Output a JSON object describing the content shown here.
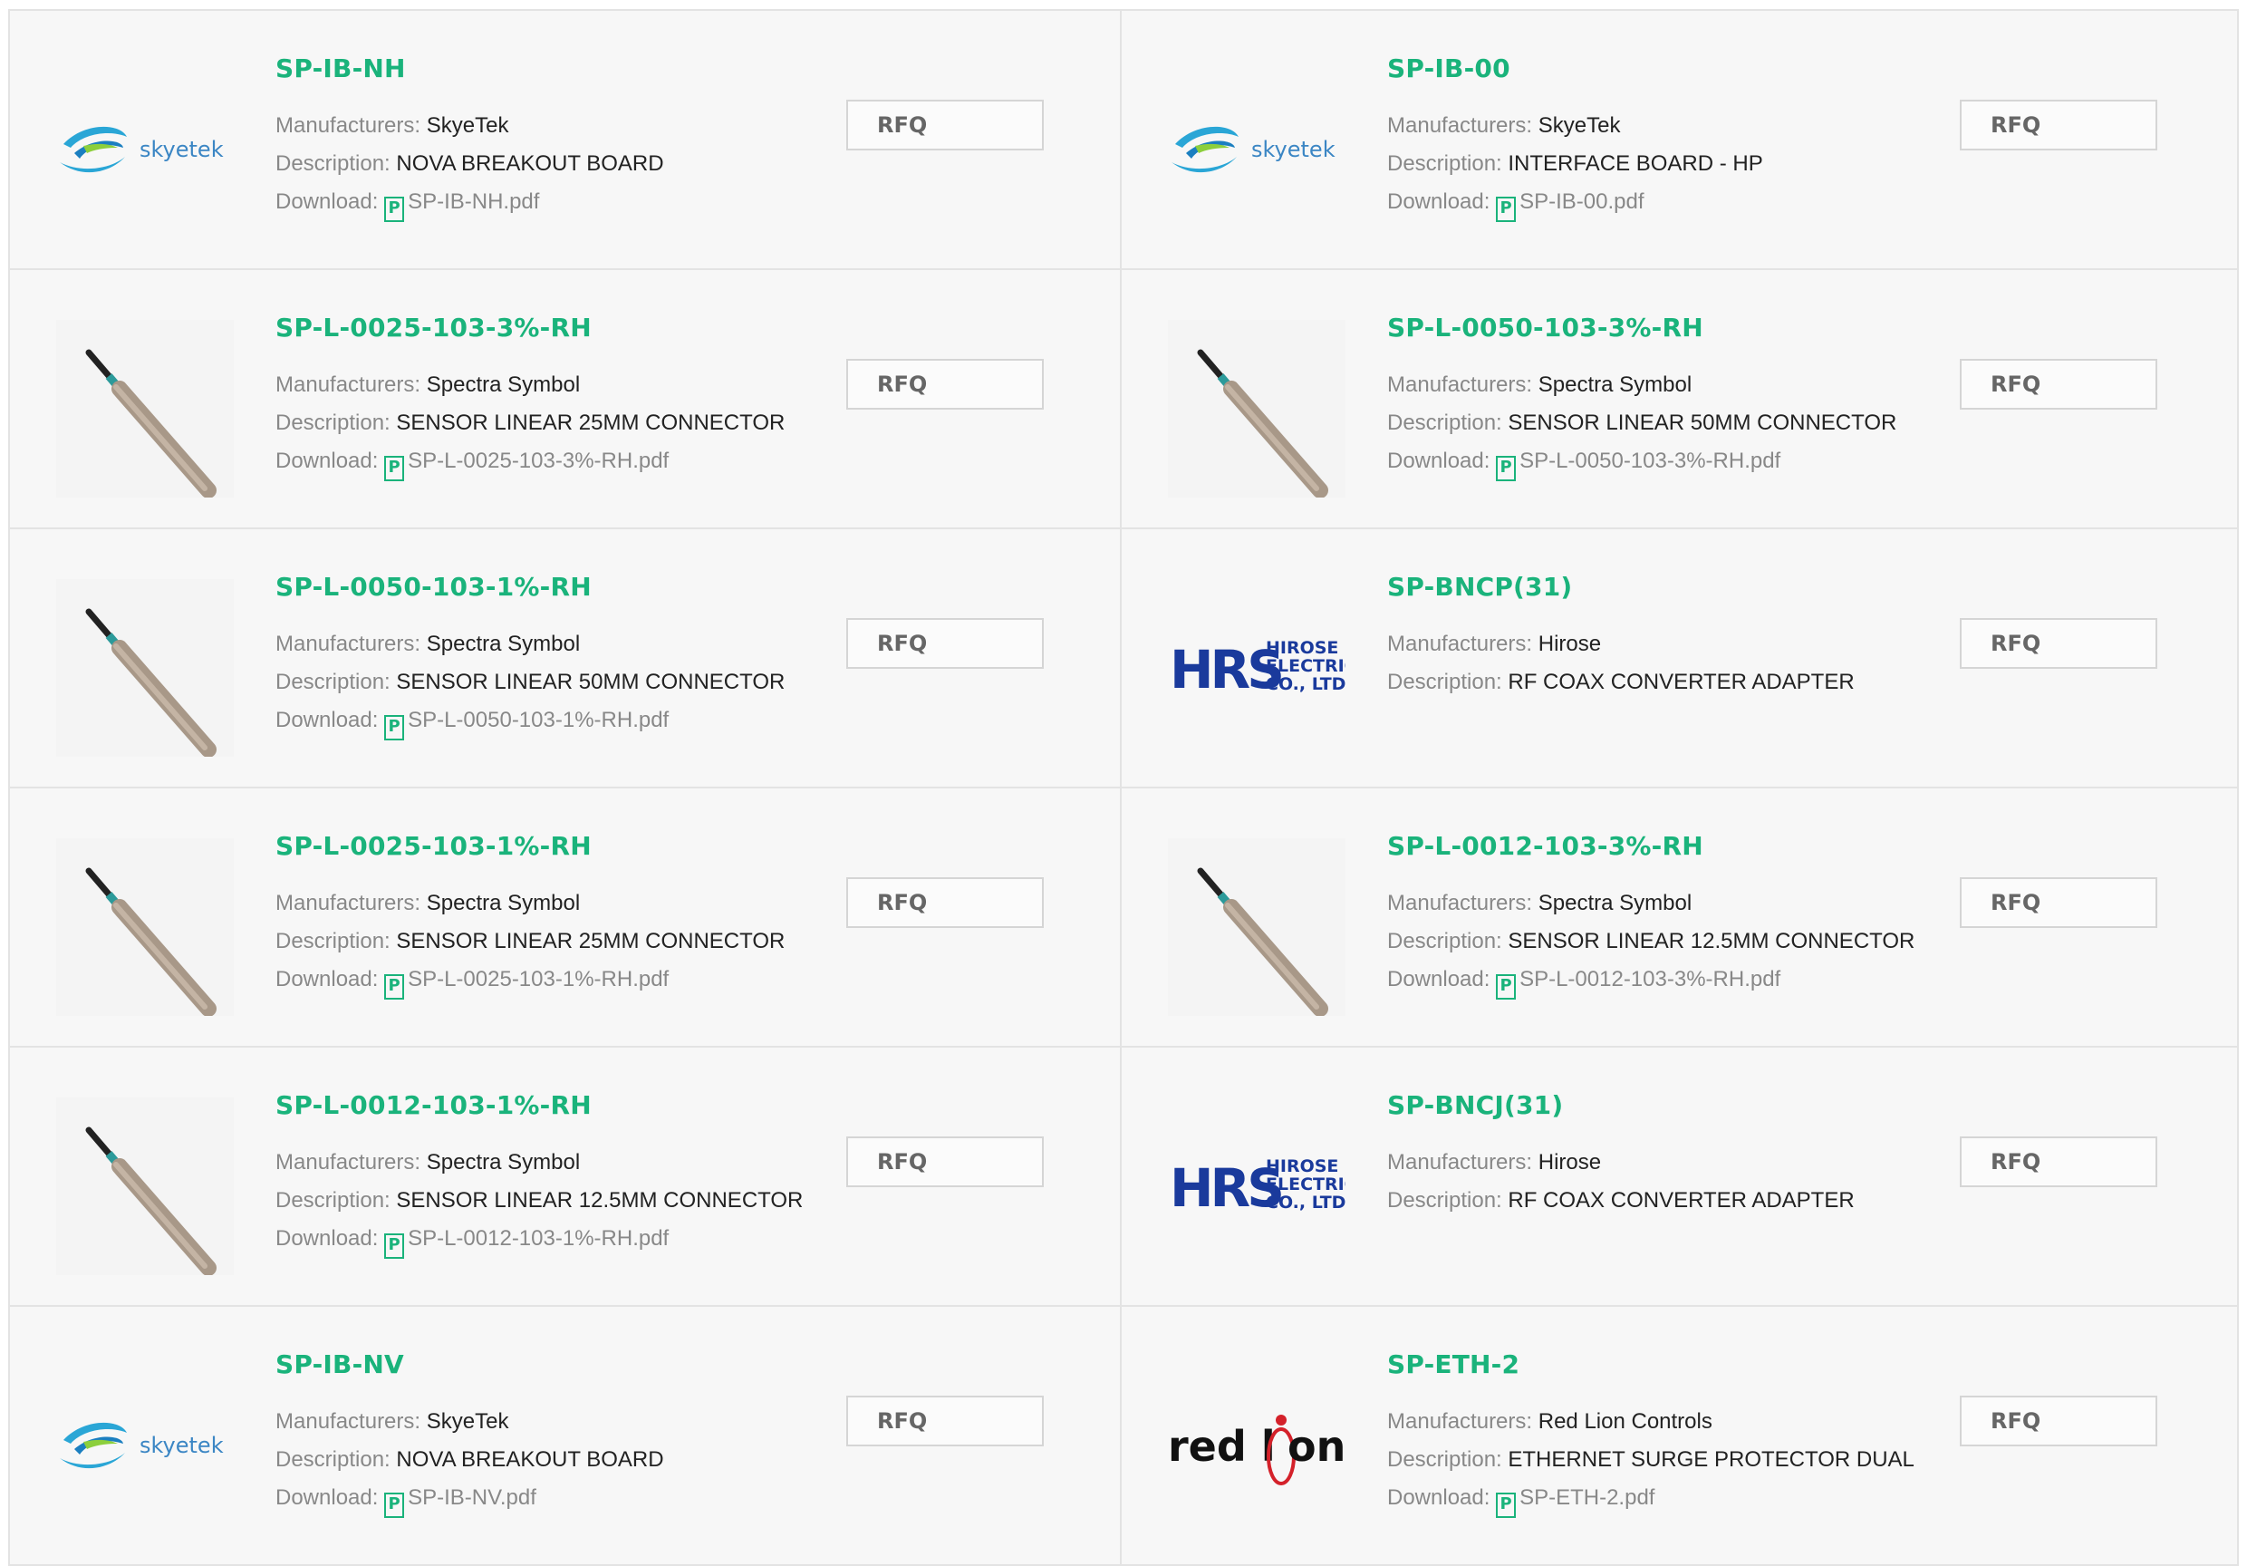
{
  "colors": {
    "accent": "#1ab37b",
    "border": "#e3e3e3",
    "card_bg": "#f7f7f7"
  },
  "labels": {
    "manufacturers": "Manufacturers:",
    "description": "Description:",
    "download": "Download:",
    "rfq": "RFQ"
  },
  "products": [
    {
      "part": "SP-IB-NH",
      "manufacturer": "SkyeTek",
      "description": "NOVA BREAKOUT BOARD",
      "download": "SP-IB-NH.pdf",
      "thumb": "skyetek-logo"
    },
    {
      "part": "SP-IB-00",
      "manufacturer": "SkyeTek",
      "description": "INTERFACE BOARD - HP",
      "download": "SP-IB-00.pdf",
      "thumb": "skyetek-logo"
    },
    {
      "part": "SP-L-0025-103-3%-RH",
      "manufacturer": "Spectra Symbol",
      "description": "SENSOR LINEAR 25MM CONNECTOR",
      "download": "SP-L-0025-103-3%-RH.pdf",
      "thumb": "sensor-image"
    },
    {
      "part": "SP-L-0050-103-3%-RH",
      "manufacturer": "Spectra Symbol",
      "description": "SENSOR LINEAR 50MM CONNECTOR",
      "download": "SP-L-0050-103-3%-RH.pdf",
      "thumb": "sensor-image"
    },
    {
      "part": "SP-L-0050-103-1%-RH",
      "manufacturer": "Spectra Symbol",
      "description": "SENSOR LINEAR 50MM CONNECTOR",
      "download": "SP-L-0050-103-1%-RH.pdf",
      "thumb": "sensor-image"
    },
    {
      "part": "SP-BNCP(31)",
      "manufacturer": "Hirose",
      "description": "RF COAX CONVERTER ADAPTER",
      "download": "",
      "thumb": "hirose-logo"
    },
    {
      "part": "SP-L-0025-103-1%-RH",
      "manufacturer": "Spectra Symbol",
      "description": "SENSOR LINEAR 25MM CONNECTOR",
      "download": "SP-L-0025-103-1%-RH.pdf",
      "thumb": "sensor-image"
    },
    {
      "part": "SP-L-0012-103-3%-RH",
      "manufacturer": "Spectra Symbol",
      "description": "SENSOR LINEAR 12.5MM CONNECTOR",
      "download": "SP-L-0012-103-3%-RH.pdf",
      "thumb": "sensor-image"
    },
    {
      "part": "SP-L-0012-103-1%-RH",
      "manufacturer": "Spectra Symbol",
      "description": "SENSOR LINEAR 12.5MM CONNECTOR",
      "download": "SP-L-0012-103-1%-RH.pdf",
      "thumb": "sensor-image"
    },
    {
      "part": "SP-BNCJ(31)",
      "manufacturer": "Hirose",
      "description": "RF COAX CONVERTER ADAPTER",
      "download": "",
      "thumb": "hirose-logo"
    },
    {
      "part": "SP-IB-NV",
      "manufacturer": "SkyeTek",
      "description": "NOVA BREAKOUT BOARD",
      "download": "SP-IB-NV.pdf",
      "thumb": "skyetek-logo"
    },
    {
      "part": "SP-ETH-2",
      "manufacturer": "Red Lion Controls",
      "description": "ETHERNET SURGE PROTECTOR DUAL",
      "download": "SP-ETH-2.pdf",
      "thumb": "redlion-logo"
    }
  ]
}
